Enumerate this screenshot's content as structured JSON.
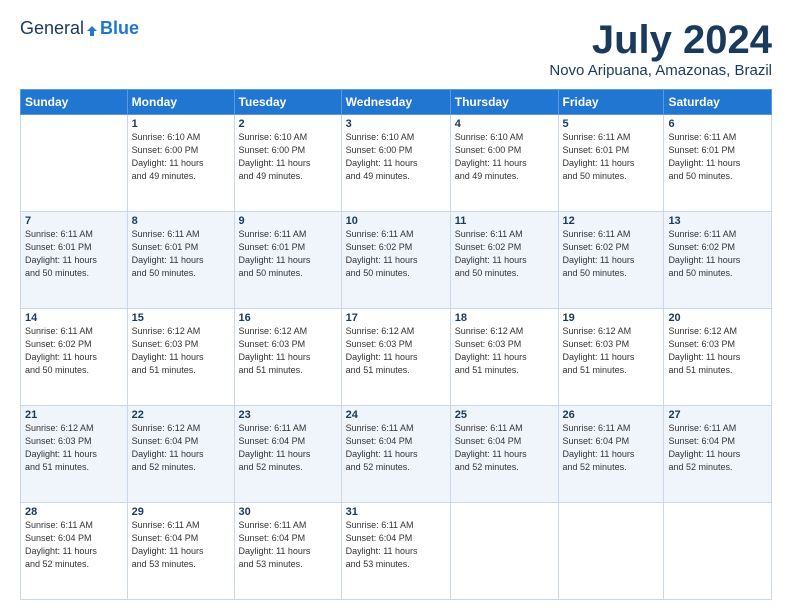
{
  "header": {
    "logo": {
      "general": "General",
      "blue": "Blue",
      "line2": ""
    },
    "title": "July 2024",
    "subtitle": "Novo Aripuana, Amazonas, Brazil"
  },
  "days_of_week": [
    "Sunday",
    "Monday",
    "Tuesday",
    "Wednesday",
    "Thursday",
    "Friday",
    "Saturday"
  ],
  "weeks": [
    [
      {
        "day": "",
        "info": ""
      },
      {
        "day": "1",
        "info": "Sunrise: 6:10 AM\nSunset: 6:00 PM\nDaylight: 11 hours\nand 49 minutes."
      },
      {
        "day": "2",
        "info": "Sunrise: 6:10 AM\nSunset: 6:00 PM\nDaylight: 11 hours\nand 49 minutes."
      },
      {
        "day": "3",
        "info": "Sunrise: 6:10 AM\nSunset: 6:00 PM\nDaylight: 11 hours\nand 49 minutes."
      },
      {
        "day": "4",
        "info": "Sunrise: 6:10 AM\nSunset: 6:00 PM\nDaylight: 11 hours\nand 49 minutes."
      },
      {
        "day": "5",
        "info": "Sunrise: 6:11 AM\nSunset: 6:01 PM\nDaylight: 11 hours\nand 50 minutes."
      },
      {
        "day": "6",
        "info": "Sunrise: 6:11 AM\nSunset: 6:01 PM\nDaylight: 11 hours\nand 50 minutes."
      }
    ],
    [
      {
        "day": "7",
        "info": "Sunrise: 6:11 AM\nSunset: 6:01 PM\nDaylight: 11 hours\nand 50 minutes."
      },
      {
        "day": "8",
        "info": "Sunrise: 6:11 AM\nSunset: 6:01 PM\nDaylight: 11 hours\nand 50 minutes."
      },
      {
        "day": "9",
        "info": "Sunrise: 6:11 AM\nSunset: 6:01 PM\nDaylight: 11 hours\nand 50 minutes."
      },
      {
        "day": "10",
        "info": "Sunrise: 6:11 AM\nSunset: 6:02 PM\nDaylight: 11 hours\nand 50 minutes."
      },
      {
        "day": "11",
        "info": "Sunrise: 6:11 AM\nSunset: 6:02 PM\nDaylight: 11 hours\nand 50 minutes."
      },
      {
        "day": "12",
        "info": "Sunrise: 6:11 AM\nSunset: 6:02 PM\nDaylight: 11 hours\nand 50 minutes."
      },
      {
        "day": "13",
        "info": "Sunrise: 6:11 AM\nSunset: 6:02 PM\nDaylight: 11 hours\nand 50 minutes."
      }
    ],
    [
      {
        "day": "14",
        "info": "Sunrise: 6:11 AM\nSunset: 6:02 PM\nDaylight: 11 hours\nand 50 minutes."
      },
      {
        "day": "15",
        "info": "Sunrise: 6:12 AM\nSunset: 6:03 PM\nDaylight: 11 hours\nand 51 minutes."
      },
      {
        "day": "16",
        "info": "Sunrise: 6:12 AM\nSunset: 6:03 PM\nDaylight: 11 hours\nand 51 minutes."
      },
      {
        "day": "17",
        "info": "Sunrise: 6:12 AM\nSunset: 6:03 PM\nDaylight: 11 hours\nand 51 minutes."
      },
      {
        "day": "18",
        "info": "Sunrise: 6:12 AM\nSunset: 6:03 PM\nDaylight: 11 hours\nand 51 minutes."
      },
      {
        "day": "19",
        "info": "Sunrise: 6:12 AM\nSunset: 6:03 PM\nDaylight: 11 hours\nand 51 minutes."
      },
      {
        "day": "20",
        "info": "Sunrise: 6:12 AM\nSunset: 6:03 PM\nDaylight: 11 hours\nand 51 minutes."
      }
    ],
    [
      {
        "day": "21",
        "info": "Sunrise: 6:12 AM\nSunset: 6:03 PM\nDaylight: 11 hours\nand 51 minutes."
      },
      {
        "day": "22",
        "info": "Sunrise: 6:12 AM\nSunset: 6:04 PM\nDaylight: 11 hours\nand 52 minutes."
      },
      {
        "day": "23",
        "info": "Sunrise: 6:11 AM\nSunset: 6:04 PM\nDaylight: 11 hours\nand 52 minutes."
      },
      {
        "day": "24",
        "info": "Sunrise: 6:11 AM\nSunset: 6:04 PM\nDaylight: 11 hours\nand 52 minutes."
      },
      {
        "day": "25",
        "info": "Sunrise: 6:11 AM\nSunset: 6:04 PM\nDaylight: 11 hours\nand 52 minutes."
      },
      {
        "day": "26",
        "info": "Sunrise: 6:11 AM\nSunset: 6:04 PM\nDaylight: 11 hours\nand 52 minutes."
      },
      {
        "day": "27",
        "info": "Sunrise: 6:11 AM\nSunset: 6:04 PM\nDaylight: 11 hours\nand 52 minutes."
      }
    ],
    [
      {
        "day": "28",
        "info": "Sunrise: 6:11 AM\nSunset: 6:04 PM\nDaylight: 11 hours\nand 52 minutes."
      },
      {
        "day": "29",
        "info": "Sunrise: 6:11 AM\nSunset: 6:04 PM\nDaylight: 11 hours\nand 53 minutes."
      },
      {
        "day": "30",
        "info": "Sunrise: 6:11 AM\nSunset: 6:04 PM\nDaylight: 11 hours\nand 53 minutes."
      },
      {
        "day": "31",
        "info": "Sunrise: 6:11 AM\nSunset: 6:04 PM\nDaylight: 11 hours\nand 53 minutes."
      },
      {
        "day": "",
        "info": ""
      },
      {
        "day": "",
        "info": ""
      },
      {
        "day": "",
        "info": ""
      }
    ]
  ]
}
